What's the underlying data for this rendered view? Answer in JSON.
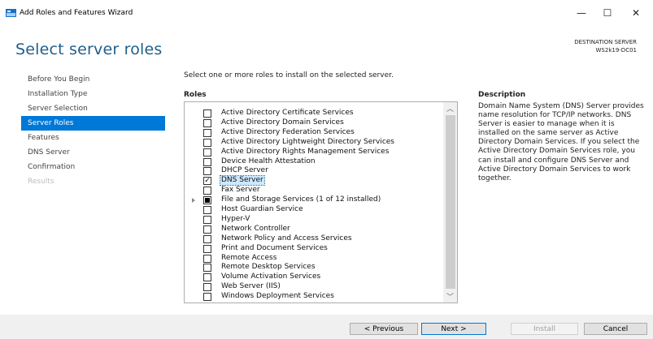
{
  "window": {
    "title": "Add Roles and Features Wizard",
    "minimize_glyph": "—",
    "maximize_glyph": "☐",
    "close_glyph": "✕"
  },
  "page": {
    "title": "Select server roles",
    "destination_label": "DESTINATION SERVER",
    "destination_server": "WS2k19-DC01",
    "instruction": "Select one or more roles to install on the selected server.",
    "roles_heading": "Roles",
    "description_heading": "Description",
    "description_text": "Domain Name System (DNS) Server provides name resolution for TCP/IP networks. DNS Server is easier to manage when it is installed on the same server as Active Directory Domain Services. If you select the Active Directory Domain Services role, you can install and configure DNS Server and Active Directory Domain Services to work together."
  },
  "nav": {
    "items": [
      {
        "label": "Before You Begin",
        "state": "normal"
      },
      {
        "label": "Installation Type",
        "state": "normal"
      },
      {
        "label": "Server Selection",
        "state": "normal"
      },
      {
        "label": "Server Roles",
        "state": "active"
      },
      {
        "label": "Features",
        "state": "normal"
      },
      {
        "label": "DNS Server",
        "state": "normal"
      },
      {
        "label": "Confirmation",
        "state": "normal"
      },
      {
        "label": "Results",
        "state": "disabled"
      }
    ]
  },
  "roles": [
    {
      "label": "Active Directory Certificate Services",
      "checked": false
    },
    {
      "label": "Active Directory Domain Services",
      "checked": false
    },
    {
      "label": "Active Directory Federation Services",
      "checked": false
    },
    {
      "label": "Active Directory Lightweight Directory Services",
      "checked": false
    },
    {
      "label": "Active Directory Rights Management Services",
      "checked": false
    },
    {
      "label": "Device Health Attestation",
      "checked": false
    },
    {
      "label": "DHCP Server",
      "checked": false
    },
    {
      "label": "DNS Server",
      "checked": true,
      "selected": true
    },
    {
      "label": "Fax Server",
      "checked": false
    },
    {
      "label": "File and Storage Services (1 of 12 installed)",
      "checked": "partial",
      "expandable": true
    },
    {
      "label": "Host Guardian Service",
      "checked": false
    },
    {
      "label": "Hyper-V",
      "checked": false
    },
    {
      "label": "Network Controller",
      "checked": false
    },
    {
      "label": "Network Policy and Access Services",
      "checked": false
    },
    {
      "label": "Print and Document Services",
      "checked": false
    },
    {
      "label": "Remote Access",
      "checked": false
    },
    {
      "label": "Remote Desktop Services",
      "checked": false
    },
    {
      "label": "Volume Activation Services",
      "checked": false
    },
    {
      "label": "Web Server (IIS)",
      "checked": false
    },
    {
      "label": "Windows Deployment Services",
      "checked": false
    }
  ],
  "buttons": {
    "previous": "< Previous",
    "next": "Next >",
    "install": "Install",
    "cancel": "Cancel"
  },
  "colors": {
    "accent": "#0078d7",
    "title": "#1f5f8b"
  }
}
